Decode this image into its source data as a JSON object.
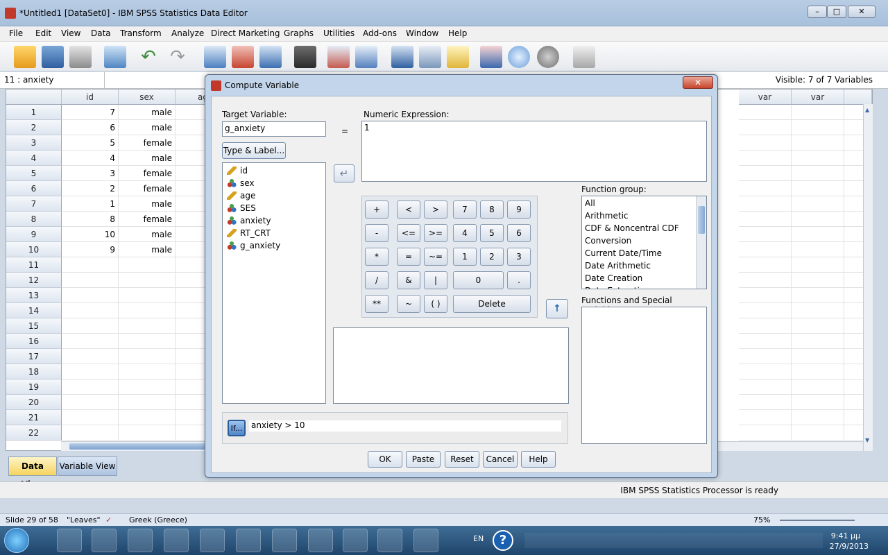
{
  "window": {
    "title": "*Untitled1 [DataSet0] - IBM SPSS Statistics Data Editor"
  },
  "menu": [
    "File",
    "Edit",
    "View",
    "Data",
    "Transform",
    "Analyze",
    "Direct Marketing",
    "Graphs",
    "Utilities",
    "Add-ons",
    "Window",
    "Help"
  ],
  "cellbar": {
    "ref": "11 : anxiety",
    "visible": "Visible: 7 of 7 Variables"
  },
  "grid": {
    "columns": [
      "id",
      "sex",
      "ag",
      "var",
      "var"
    ],
    "rows": [
      {
        "n": "1",
        "id": "7",
        "sex": "male"
      },
      {
        "n": "2",
        "id": "6",
        "sex": "male"
      },
      {
        "n": "3",
        "id": "5",
        "sex": "female"
      },
      {
        "n": "4",
        "id": "4",
        "sex": "male"
      },
      {
        "n": "5",
        "id": "3",
        "sex": "female"
      },
      {
        "n": "6",
        "id": "2",
        "sex": "female"
      },
      {
        "n": "7",
        "id": "1",
        "sex": "male"
      },
      {
        "n": "8",
        "id": "8",
        "sex": "female"
      },
      {
        "n": "9",
        "id": "10",
        "sex": "male"
      },
      {
        "n": "10",
        "id": "9",
        "sex": "male"
      },
      {
        "n": "11",
        "id": "",
        "sex": ""
      },
      {
        "n": "12",
        "id": "",
        "sex": ""
      },
      {
        "n": "13",
        "id": "",
        "sex": ""
      },
      {
        "n": "14",
        "id": "",
        "sex": ""
      },
      {
        "n": "15",
        "id": "",
        "sex": ""
      },
      {
        "n": "16",
        "id": "",
        "sex": ""
      },
      {
        "n": "17",
        "id": "",
        "sex": ""
      },
      {
        "n": "18",
        "id": "",
        "sex": ""
      },
      {
        "n": "19",
        "id": "",
        "sex": ""
      },
      {
        "n": "20",
        "id": "",
        "sex": ""
      },
      {
        "n": "21",
        "id": "",
        "sex": ""
      },
      {
        "n": "22",
        "id": "",
        "sex": ""
      }
    ]
  },
  "tabs": {
    "data_view": "Data View",
    "variable_view": "Variable View"
  },
  "status": "IBM SPSS Statistics Processor is ready",
  "ppt": {
    "slide": "Slide 29 of 58",
    "theme": "\"Leaves\"",
    "lang": "Greek (Greece)",
    "zoom": "75%"
  },
  "taskbar": {
    "lang": "EN",
    "time": "9:41 μμ",
    "date": "27/9/2013"
  },
  "dialog": {
    "title": "Compute Variable",
    "target_label": "Target Variable:",
    "target_value": "g_anxiety",
    "equals": "=",
    "expr_label": "Numeric Expression:",
    "expr_value": "1",
    "type_label_btn": "Type & Label...",
    "variables": [
      {
        "name": "id",
        "icon": "ruler-icon"
      },
      {
        "name": "sex",
        "icon": "nominal-icon"
      },
      {
        "name": "age",
        "icon": "ruler-icon"
      },
      {
        "name": "SES",
        "icon": "nominal-icon"
      },
      {
        "name": "anxiety",
        "icon": "nominal-icon"
      },
      {
        "name": "RT_CRT",
        "icon": "ruler-icon"
      },
      {
        "name": "g_anxiety",
        "icon": "nominal-icon"
      }
    ],
    "keypad": [
      "+",
      "<",
      ">",
      "7",
      "8",
      "9",
      "-",
      "<=",
      ">=",
      "4",
      "5",
      "6",
      "*",
      "=",
      "~=",
      "1",
      "2",
      "3",
      "/",
      "&",
      "|",
      "0",
      ".",
      "**",
      "~",
      "( )",
      "Delete"
    ],
    "function_group_label": "Function group:",
    "function_groups": [
      "All",
      "Arithmetic",
      "CDF & Noncentral CDF",
      "Conversion",
      "Current Date/Time",
      "Date Arithmetic",
      "Date Creation",
      "Date Extraction"
    ],
    "functions_label": "Functions and Special Variables:",
    "if_btn": "If...",
    "if_condition": "anxiety  >  10",
    "buttons": {
      "ok": "OK",
      "paste": "Paste",
      "reset": "Reset",
      "cancel": "Cancel",
      "help": "Help"
    }
  }
}
